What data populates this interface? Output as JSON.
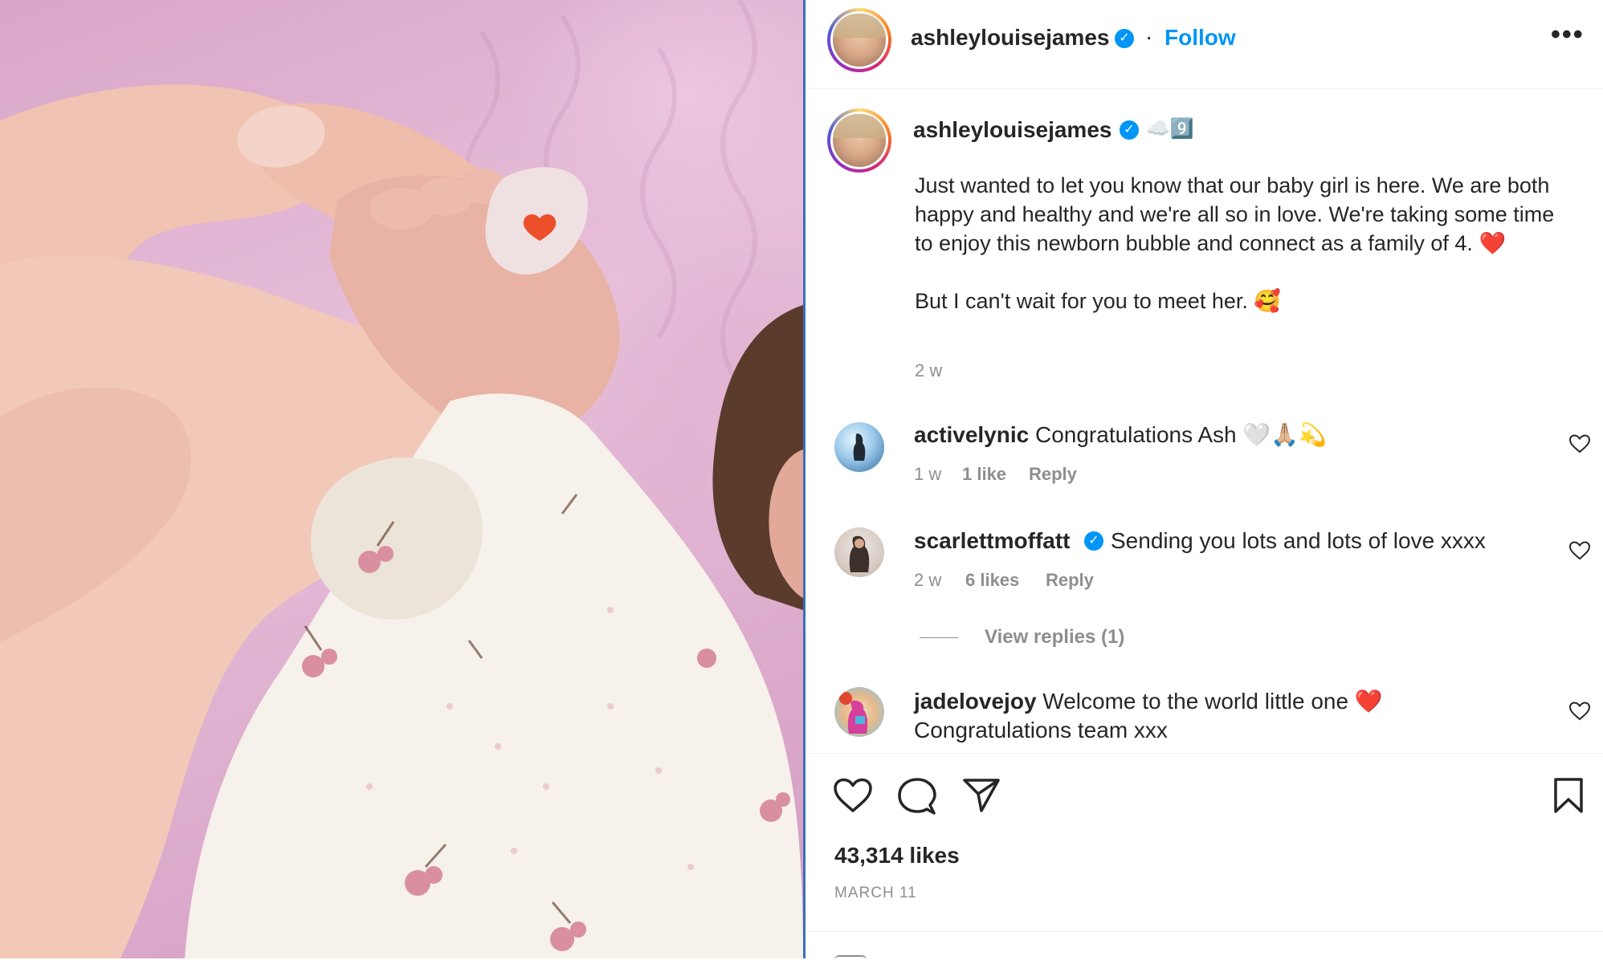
{
  "post": {
    "author": "ashleylouisejames",
    "follow_label": "Follow",
    "more_label": "•••",
    "caption_emoji": "☁️9️⃣",
    "caption_paragraph_1": "Just wanted to let you know that our baby girl is here. We are both happy and healthy and we're all so in love. We're taking some time to enjoy this newborn bubble and connect as a family of 4.",
    "caption_paragraph_1_emoji": "❤️",
    "caption_paragraph_2": "But I can't wait for you to meet her.",
    "caption_paragraph_2_emoji": "🥰",
    "caption_time": "2 w",
    "likes": "43,314 likes",
    "date": "MARCH 11"
  },
  "comments": [
    {
      "user": "activelynic",
      "text": "Congratulations Ash 🤍🙏🏼💫",
      "time": "1 w",
      "likes": "1 like",
      "reply_label": "Reply"
    },
    {
      "user": "scarlettmoffatt",
      "text": "Sending you lots and lots of love xxxx",
      "time": "2 w",
      "likes": "6 likes",
      "reply_label": "Reply",
      "view_replies": "View replies (1)"
    },
    {
      "user": "jadelovejoy",
      "text_line_1": "Welcome to the world little one ❤️",
      "text_line_2": "Congratulations team xxx"
    }
  ],
  "icons": {
    "like": "heart-icon",
    "comment": "comment-icon",
    "share": "share-icon",
    "save": "bookmark-icon",
    "verified": "verified-badge-icon",
    "more": "more-options-icon"
  },
  "colors": {
    "link": "#0095f6",
    "muted": "#8e8e8e",
    "text": "#262626",
    "heart_red": "#e0192b",
    "photo_pink": "#d9a6c9"
  }
}
